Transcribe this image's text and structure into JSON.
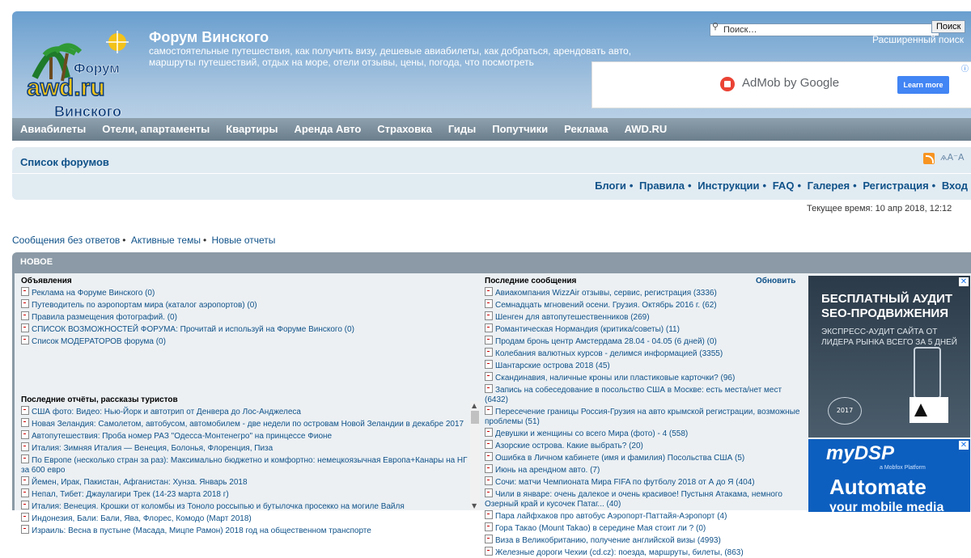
{
  "header": {
    "logo_text": [
      "Форум",
      "awd.ru",
      "Винского"
    ],
    "title": "Форум Винского",
    "description": "самостоятельные путешествия, как получить визу, дешевые авиабилеты, как добраться, арендовать авто, маршруты путешествий, отдых на море, отели отзывы, цены, погода, что посмотреть",
    "search_placeholder": "Поиск…",
    "search_button": "Поиск",
    "advanced_search": "Расширенный поиск",
    "ad": {
      "brand": "AdMob by Google",
      "button": "Learn more",
      "x": "ⓘ"
    }
  },
  "nav": [
    "Авиабилеты",
    "Отели, апартаменты",
    "Квартиры",
    "Аренда Авто",
    "Страховка",
    "Гиды",
    "Попутчики",
    "Реклама",
    "AWD.RU"
  ],
  "breadcrumb": "Список форумов",
  "font_size_icon": "ѧA⁻A",
  "links": [
    "Блоги",
    "Правила",
    "Инструкции",
    "FAQ",
    "Галерея",
    "Регистрация",
    "Вход"
  ],
  "current_time": "Текущее время: 10 апр 2018, 12:12",
  "quick_links": [
    "Сообщения без ответов",
    "Активные темы",
    "Новые отчеты"
  ],
  "new_box": {
    "caption": "НОВОЕ",
    "announcements_head": "Объявления",
    "announcements": [
      "Реклама на Форуме Винского (0)",
      "Путеводитель по аэропортам мира (каталог аэропортов) (0)",
      "Правила размещения фотографий. (0)",
      "СПИСОК ВОЗМОЖНОСТЕЙ ФОРУМА: Прочитай и используй на Форуме Винского (0)",
      "Список МОДЕРАТОРОВ форума (0)"
    ],
    "reports_head": "Последние отчёты, рассказы туристов",
    "reports": [
      "США фото: Видео: Нью-Йорк и автотрип от Денвера до Лос-Анджелеса",
      "Новая Зеландия: Самолетом, автобусом, автомобилем - две недели по островам Новой Зеландии в декабре 2017",
      "Автопутешествия: Проба номер РАЗ \"Одесса-Монтенегро\" на принцессе Фионе",
      "Италия: Зимняя Италия — Венеция, Болонья, Флоренция, Пиза",
      "По Европе (несколько стран за раз): Максимально бюджетно и комфортно: немецкоязычная Европа+Канары на НГ за 600 евро",
      "Йемен, Ирак, Пакистан, Афганистан: Хунза. Январь 2018",
      "Непал, Тибет: Джаулагири Трек (14-23 марта 2018 г)",
      "Италия: Венеция. Крошки от коломбы из Тоноло россыпью и бутылочка просекко на могиле Вайля",
      "Индонезия, Бали: Бали, Ява, Флорес, Комодо (Март 2018)",
      "Израиль: Весна в пустыне (Масада, Мицпе Рамон) 2018 год на общественном транспорте"
    ],
    "latest_head": "Последние сообщения",
    "refresh": "Обновить",
    "latest": [
      "Авиакомпания WizzAir отзывы, сервис, регистрация (3336)",
      "Семнадцать мгновений осени. Грузия. Октябрь 2016 г. (62)",
      "Шенген для автопутешественников (269)",
      "Романтическая Нормандия (критика/советы) (11)",
      "Продам бронь центр Амстердама 28.04 - 04.05 (6 дней) (0)",
      "Колебания валютных курсов - делимся информацией (3355)",
      "Шантарские острова 2018 (45)",
      "Скандинавия, наличные кроны или пластиковые карточки? (96)",
      "Запись на собеседование в посольство США в Москве: есть места/нет мест (6432)",
      "Пересечение границы Россия-Грузия на авто крымской регистрации, возможные проблемы (51)",
      "Девушки и женщины со всего Мира (фото) - 4 (558)",
      "Азорские острова. Какие выбрать? (20)",
      "Ошибка в Личном кабинете (имя и фамилия) Посольства США (5)",
      "Июнь на арендном авто. (7)",
      "Сочи: матчи Чемпионата Мира FIFA по футболу 2018 от А до Я (404)",
      "Чили в январе: очень далекое и очень красивое! Пустыня Атакама, немного Озерный край и кусочек Патаг... (40)",
      "Пара лайфхаков про автобус Аэропорт-Паттайя-Аэропорт (4)",
      "Гора Такао (Mount Takao) в середине Мая стоит ли ? (0)",
      "Виза в Великобританию, получение английской визы (4993)",
      "Железные дороги Чехии (cd.cz): поезда, маршруты, билеты, (863)"
    ]
  },
  "ad_seo": {
    "headline": "БЕСПЛАТНЫЙ АУДИТ SEO-ПРОДВИЖЕНИЯ",
    "sub": "ЭКСПРЕСС-АУДИТ САЙТА ОТ ЛИДЕРА РЫНКА ВСЕГО ЗА 5 ДНЕЙ",
    "badge": "2017"
  },
  "ad_mydsp": {
    "brand": "myDSP",
    "sub": "a Mobfox Platform",
    "word1": "Automate",
    "word2": "your mobile media"
  }
}
